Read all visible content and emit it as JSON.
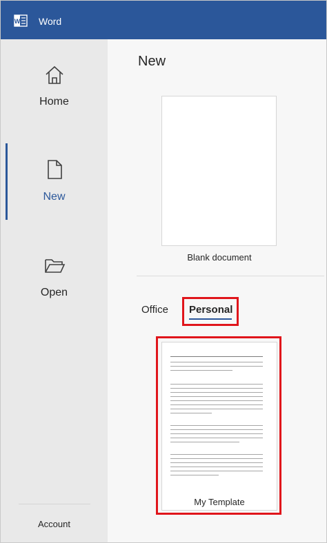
{
  "app": {
    "name": "Word",
    "icon": "word-app-icon",
    "accent_color": "#2b579a"
  },
  "sidebar": {
    "items": [
      {
        "label": "Home",
        "icon": "home-icon",
        "active": false
      },
      {
        "label": "New",
        "icon": "new-document-icon",
        "active": true
      },
      {
        "label": "Open",
        "icon": "open-folder-icon",
        "active": false
      }
    ],
    "account_label": "Account"
  },
  "main": {
    "title": "New",
    "blank_document_label": "Blank document",
    "tabs": [
      {
        "label": "Office",
        "selected": false
      },
      {
        "label": "Personal",
        "selected": true
      }
    ],
    "templates": [
      {
        "label": "My Template"
      }
    ],
    "highlight_color": "#e0151b"
  }
}
